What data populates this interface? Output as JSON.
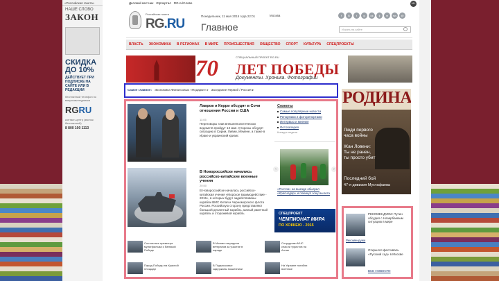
{
  "stripe_colors": [
    "#d9d2c0",
    "#c4a37a",
    "#b05a36",
    "#e8e0d0",
    "#6fa03a",
    "#4b86c7",
    "#c6a24a",
    "#8a3d8a",
    "#d9d2c0",
    "#3f6fb0",
    "#b54a3a",
    "#e8e0d0",
    "#5f9a3f",
    "#d6b06a",
    "#7a2f5c",
    "#4a7fbf",
    "#c2562f",
    "#e5dccb",
    "#7b9b3a",
    "#3b5fa0"
  ],
  "left_ad": {
    "topline": "«Российская газета»",
    "law_line1": "НАШЕ СЛОВО",
    "law_line2": "ЗАКОН",
    "discount": "СКИДКА ДО 10%",
    "discount_sub": "ДЕЙСТВУЕТ ПРИ ПОДПИСКЕ НА САЙТЕ ИЛИ В РЕДАКЦИИ",
    "small": "бесплатный телефон по вопросам подписки",
    "rg_logo_a": "RG",
    "rg_logo_b": "RU",
    "contact": "контакт-центр (звонок бесплатный)",
    "phone": "8 800 100 1113"
  },
  "topbar": {
    "links": [
      "Деловой вестник",
      "Юрпортал",
      "RG.ru/Слово"
    ],
    "badge": "16+"
  },
  "header": {
    "logo_sub": "Российская газета",
    "logo_rg": "RG",
    "logo_ru": ".RU",
    "date": "Понедельник, 11 мая 2015 года 22:01",
    "city": "Москва",
    "section": "Главное",
    "search_placeholder": "Искать на сайте",
    "social": [
      "f",
      "В",
      "t",
      "g",
      "ok",
      "lj",
      "m",
      "rss",
      "@"
    ]
  },
  "nav": [
    "ВЛАСТЬ",
    "ЭКОНОМИКА",
    "В РЕГИОНАХ",
    "В МИРЕ",
    "ПРОИСШЕСТВИЯ",
    "ОБЩЕСТВО",
    "СПОРТ",
    "КУЛЬТУРА",
    "СПЕЦПРОЕКТЫ"
  ],
  "banner": {
    "sub": "СПЕЦИАЛЬНЫЙ ПРОЕКТ RG.RU",
    "big": "70",
    "title": "ЛЕТ ПОБЕДЫ",
    "docs": "Документы. Хроника. Фотографии"
  },
  "topics": {
    "label": "Самое главное:",
    "items": [
      "Экономика Финансовых «Подарки» ▸",
      "Заседание Первой / Россия ▸"
    ]
  },
  "stories": [
    {
      "title": "Лавров и Керри обсудят в Сочи отношения России и США",
      "meta": "11:05",
      "text": "Переговоры глав внешнеполитических ведомств пройдут 12 мая. Стороны обсудят ситуацию в Сирии, Ливии, Йемене, а также в Ираке и украинский кризис"
    },
    {
      "title": "В Новороссийске начались российско-китайские военные учения",
      "meta": "20:50",
      "text": "В Новороссийске началась российско-китайская учения «Морское взаимодействие - 2015», в которых будут задействованы корабли ВМС Китая и Черноморского флота России. Российскую сторону представляют большой десантный корабль, малый ракетный корабль и сторожевой корабль"
    }
  ],
  "thumbs": [
    "Состоялась премьера мультфильма о Великой Победе",
    "В Москве наградили ветеранов за участие в параде",
    "Сотрудники МЧС спасли туристов на Алтае",
    "Парад Победы на Красной площади",
    "В Подмосковье задержаны мошенники",
    "На Украине погибли военные"
  ],
  "mid": {
    "header": "Сюжеты",
    "items": [
      "Самые популярные новости",
      "Репортажи и фоторепортажи",
      "Интервью и мнения",
      "Фотогалерея"
    ],
    "date": "Конкурс недели",
    "caption": "«Ростов» на выезде обыграл «Краснодар» и покинул зону вылета"
  },
  "hockey": {
    "line1": "СПЕЦПРОЕКТ",
    "line2": "ЧЕМПИОНАТ МИРА",
    "line3": "ПО ХОККЕЮ - 2015"
  },
  "rodina": {
    "title": "РОДИНА",
    "line1": "Люди первого",
    "line2": "часа войны",
    "line3": "Жан Ловени:",
    "line4": "Ты не ранен,",
    "line5": "ты просто убит",
    "line6": "Последний бой",
    "line7": "47-я дивизия Мустафаева"
  },
  "side": {
    "item1": "РЕКОМЕНДУЕМ: Путин обсудил с Назарбаевым ситуацию в мире",
    "link1": "Рекомендуем",
    "item2": "Открылся фестиваль «Русский сад» в Москве",
    "link2": "ВСЕ НОВОСТИ"
  }
}
